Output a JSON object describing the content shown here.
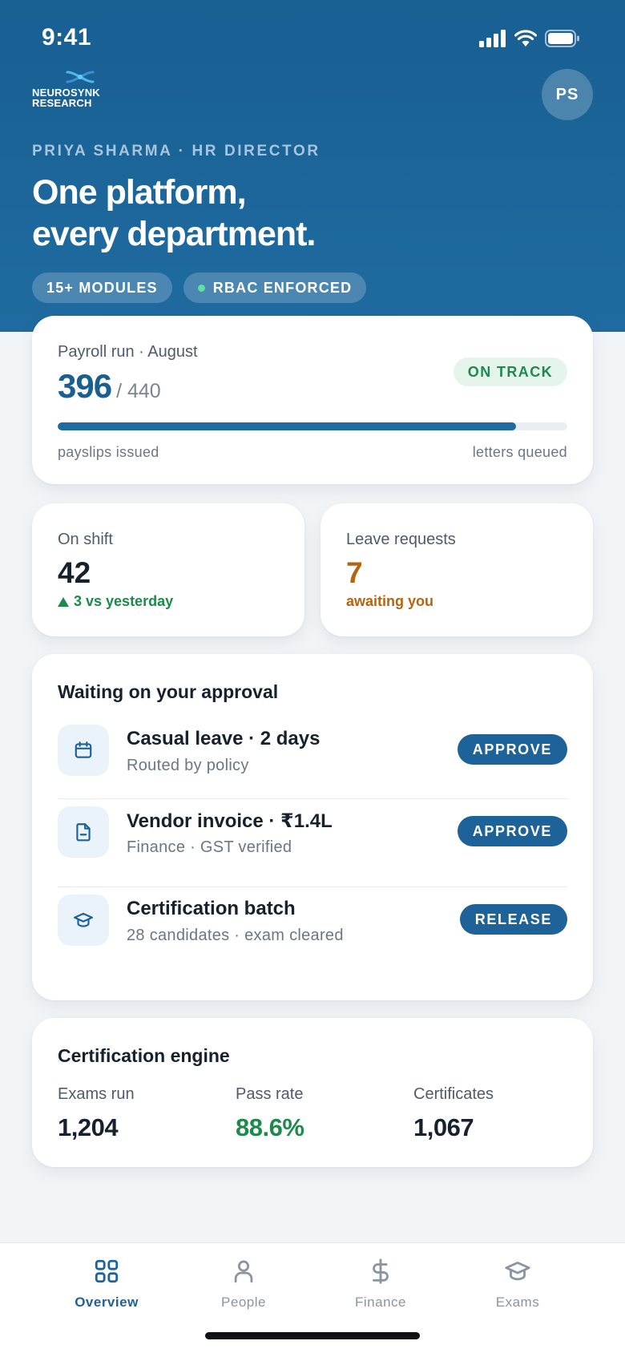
{
  "status_bar": {
    "time": "9:41"
  },
  "brand": {
    "line1": "NEUROSYNK",
    "line2": "RESEARCH"
  },
  "user": {
    "initials": "PS",
    "role_line": "PRIYA SHARMA · HR DIRECTOR"
  },
  "hero": {
    "headline_line1": "One platform,",
    "headline_line2": "every department.",
    "chips": [
      {
        "label": "15+ MODULES"
      },
      {
        "label": "RBAC ENFORCED",
        "dot_color": "#5fe0a6"
      }
    ]
  },
  "payroll": {
    "title": "Payroll run · August",
    "issued": "396",
    "total": "/ 440",
    "status": "ON TRACK",
    "progress_fraction": 0.9,
    "left_label": "payslips issued",
    "right_label": "letters queued"
  },
  "stats": {
    "on_shift": {
      "label": "On shift",
      "value": "42",
      "sub": "3 vs yesterday",
      "sub_color": "#1d8a4c"
    },
    "leave": {
      "label": "Leave requests",
      "value": "7",
      "sub": "awaiting you",
      "color": "#b5640f"
    }
  },
  "approvals": {
    "title": "Waiting on your approval",
    "items": [
      {
        "icon": "calendar-icon",
        "title": "Casual leave · 2 days",
        "subtitle": "Routed by policy",
        "action": "APPROVE"
      },
      {
        "icon": "document-icon",
        "title": "Vendor invoice · ₹1.4L",
        "subtitle": "Finance · GST verified",
        "action": "APPROVE"
      },
      {
        "icon": "graduation-cap-icon",
        "title": "Certification batch",
        "subtitle": "28 candidates · exam cleared",
        "action": "RELEASE"
      }
    ]
  },
  "certification": {
    "title": "Certification engine",
    "metrics": [
      {
        "label": "Exams run",
        "value": "1,204"
      },
      {
        "label": "Pass rate",
        "value": "88.6%",
        "color": "#1d8a4c"
      },
      {
        "label": "Certificates",
        "value": "1,067"
      }
    ]
  },
  "tabbar": {
    "tabs": [
      {
        "label": "Overview",
        "icon": "grid-icon",
        "active": true
      },
      {
        "label": "People",
        "icon": "person-icon",
        "active": false
      },
      {
        "label": "Finance",
        "icon": "dollar-icon",
        "active": false
      },
      {
        "label": "Exams",
        "icon": "graduation-cap-icon",
        "active": false
      }
    ]
  },
  "colors": {
    "brand": "#185f92",
    "accent": "#1d6298",
    "success": "#1d8a4c",
    "warning": "#b5640f"
  }
}
